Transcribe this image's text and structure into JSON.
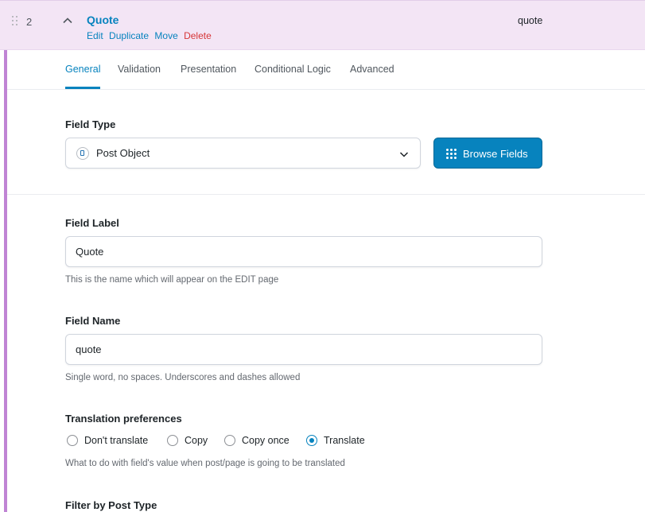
{
  "header": {
    "order": "2",
    "field_label": "Quote",
    "actions": {
      "edit": "Edit",
      "duplicate": "Duplicate",
      "move": "Move",
      "delete": "Delete"
    },
    "field_name": "quote"
  },
  "tabs": [
    "General",
    "Validation",
    "Presentation",
    "Conditional Logic",
    "Advanced"
  ],
  "field_type": {
    "label": "Field Type",
    "value": "Post Object",
    "browse_button": "Browse Fields"
  },
  "field_label": {
    "label": "Field Label",
    "value": "Quote",
    "help": "This is the name which will appear on the EDIT page"
  },
  "field_name": {
    "label": "Field Name",
    "value": "quote",
    "help": "Single word, no spaces. Underscores and dashes allowed"
  },
  "translation": {
    "label": "Translation preferences",
    "options": [
      "Don't translate",
      "Copy",
      "Copy once",
      "Translate"
    ],
    "selected": "Translate",
    "help": "What to do with field's value when post/page is going to be translated"
  },
  "filter_post_type": {
    "label": "Filter by Post Type"
  },
  "colors": {
    "accent": "#0783be",
    "header_bg": "#f3e5f5",
    "accent_bar": "#c084d4",
    "delete": "#d63638"
  }
}
